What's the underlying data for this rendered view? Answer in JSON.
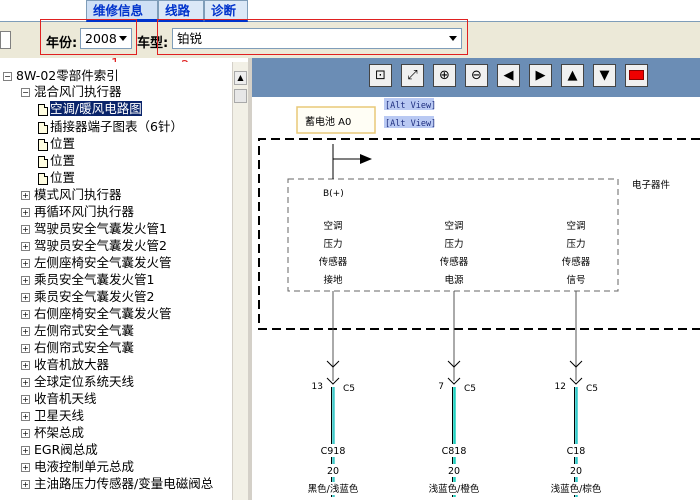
{
  "tabs": [
    {
      "label": "维修信息"
    },
    {
      "label": "线路"
    },
    {
      "label": "诊断"
    }
  ],
  "filters": {
    "year_label": "年份:",
    "year_value": "2008",
    "model_label": "车型:",
    "model_value": "铂锐",
    "marker_1": "1",
    "marker_2": "2"
  },
  "tree": {
    "root": "8W-02零部件索引",
    "group": "混合风门执行器",
    "children": [
      "空调/暖风电路图",
      "插接器端子图表（6针）",
      "位置",
      "位置",
      "位置"
    ],
    "items": [
      "模式风门执行器",
      "再循环风门执行器",
      "驾驶员安全气囊发火管1",
      "驾驶员安全气囊发火管2",
      "左侧座椅安全气囊发火管",
      "乘员安全气囊发火管1",
      "乘员安全气囊发火管2",
      "右侧座椅安全气囊发火管",
      "左侧帘式安全气囊",
      "右侧帘式安全气囊",
      "收音机放大器",
      "全球定位系统天线",
      "收音机天线",
      "卫星天线",
      "杯架总成",
      "EGR阀总成",
      "电液控制单元总成",
      "主油路压力传感器/变量电磁阀总"
    ]
  },
  "toolbar_icons": [
    "fit-page-icon",
    "fit-width-icon",
    "zoom-in-icon",
    "zoom-out-icon",
    "arrow-left-icon",
    "arrow-right-icon",
    "arrow-up-icon",
    "arrow-down-icon",
    "red-flag-icon"
  ],
  "diagram": {
    "alt_view_1": "[Alt View]",
    "alt_view_2": "[Alt View]",
    "battery": "蓄电池 A0",
    "module_label": "电子器件",
    "bplus": "B(+)",
    "sensors": [
      {
        "lines": [
          "空调",
          "压力",
          "传感器",
          "接地"
        ],
        "pin": "13",
        "conn": "C5",
        "wire": "C918",
        "gauge": "20",
        "color": "黑色/浅蓝色",
        "wire_hex": "#40c8c8"
      },
      {
        "lines": [
          "空调",
          "压力",
          "传感器",
          "电源"
        ],
        "pin": "7",
        "conn": "C5",
        "wire": "C818",
        "gauge": "20",
        "color": "浅蓝色/橙色",
        "wire_hex": "#20d0c0"
      },
      {
        "lines": [
          "空调",
          "压力",
          "传感器",
          "信号"
        ],
        "pin": "12",
        "conn": "C5",
        "wire": "C18",
        "gauge": "20",
        "color": "浅蓝色/棕色",
        "wire_hex": "#30c8c8"
      }
    ]
  }
}
